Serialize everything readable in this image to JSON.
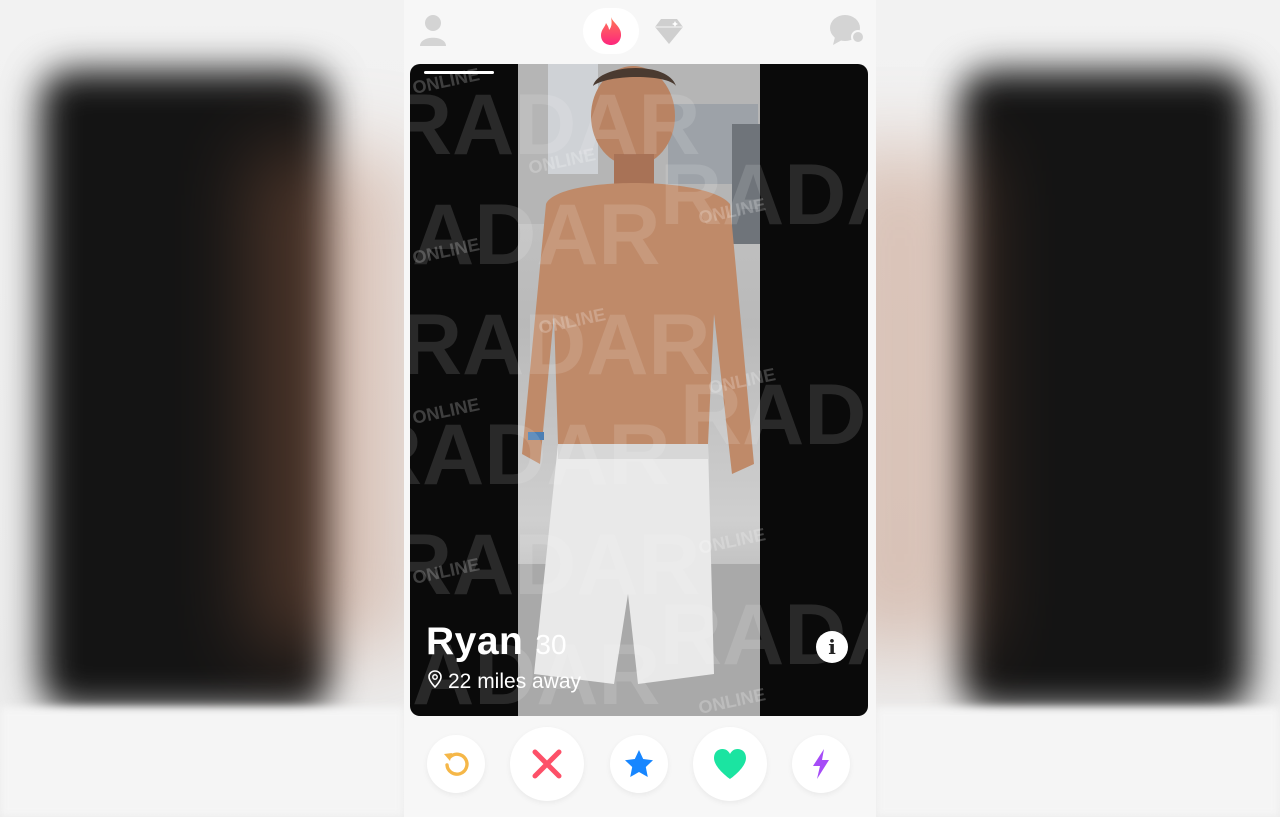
{
  "app": {
    "name": "Tinder",
    "brand_color": "#fd5068"
  },
  "topbar": {
    "icons": [
      "profile-icon",
      "flame-icon",
      "gem-icon",
      "chat-icon"
    ]
  },
  "profile_card": {
    "name": "Ryan",
    "age": "30",
    "distance": "22 miles away",
    "info_label": "i",
    "photo_index": 1,
    "photo_count": 1
  },
  "watermark": {
    "big": "RADAR",
    "small": "ONLINE"
  },
  "actions": [
    {
      "name": "rewind",
      "icon": "rewind-icon",
      "color": "#f5b748"
    },
    {
      "name": "nope",
      "icon": "close-icon",
      "color": "#fd5068"
    },
    {
      "name": "super-like",
      "icon": "star-icon",
      "color": "#1786ff"
    },
    {
      "name": "like",
      "icon": "heart-icon",
      "color": "#1be4a1"
    },
    {
      "name": "boost",
      "icon": "lightning-icon",
      "color": "#a64cf7"
    }
  ]
}
